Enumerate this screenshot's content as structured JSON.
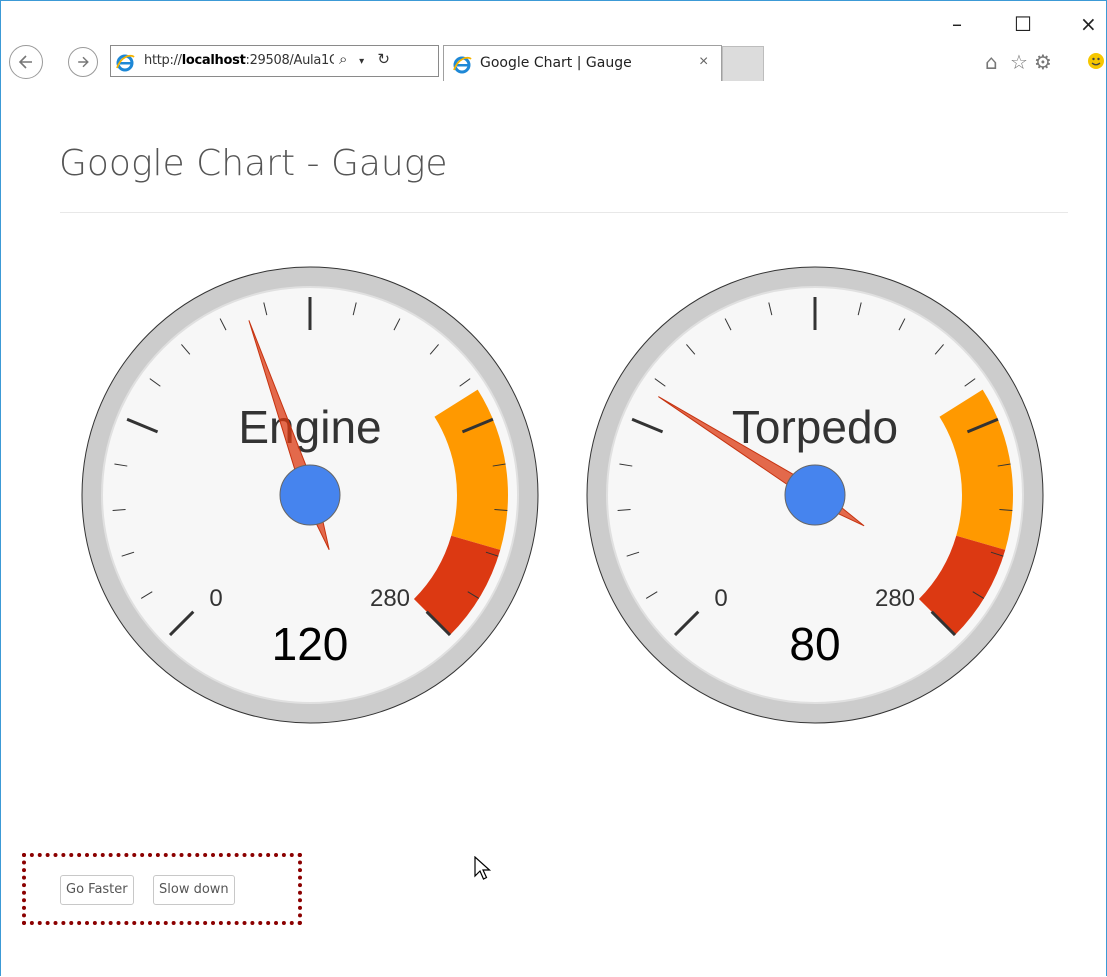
{
  "browser": {
    "address_url_prefix": "http://",
    "address_url_host": "localhost",
    "address_url_rest": ":29508/Aula1C",
    "tab_title": "Google Chart | Gauge",
    "tab_close": "×",
    "window_controls": {
      "minimize": "–",
      "maximize": "☐",
      "close": "×"
    }
  },
  "page": {
    "title": "Google Chart - Gauge"
  },
  "chart_data": [
    {
      "type": "gauge",
      "label": "Engine",
      "value": 120,
      "min": 0,
      "max": 280,
      "min_label": "0",
      "max_label": "280",
      "value_label": "120",
      "bands": [
        {
          "from": 200,
          "to": 250,
          "color": "#ff9900"
        },
        {
          "from": 250,
          "to": 280,
          "color": "#dc3912"
        }
      ],
      "major_ticks": 5,
      "minor_ticks": 5
    },
    {
      "type": "gauge",
      "label": "Torpedo",
      "value": 80,
      "min": 0,
      "max": 280,
      "min_label": "0",
      "max_label": "280",
      "value_label": "80",
      "bands": [
        {
          "from": 200,
          "to": 250,
          "color": "#ff9900"
        },
        {
          "from": 250,
          "to": 280,
          "color": "#dc3912"
        }
      ],
      "major_ticks": 5,
      "minor_ticks": 5
    }
  ],
  "buttons": {
    "go_faster": "Go Faster",
    "slow_down": "Slow down"
  },
  "colors": {
    "needle": "#dc3912",
    "hub": "#4684ee",
    "highlight_box": "#8b0000"
  }
}
